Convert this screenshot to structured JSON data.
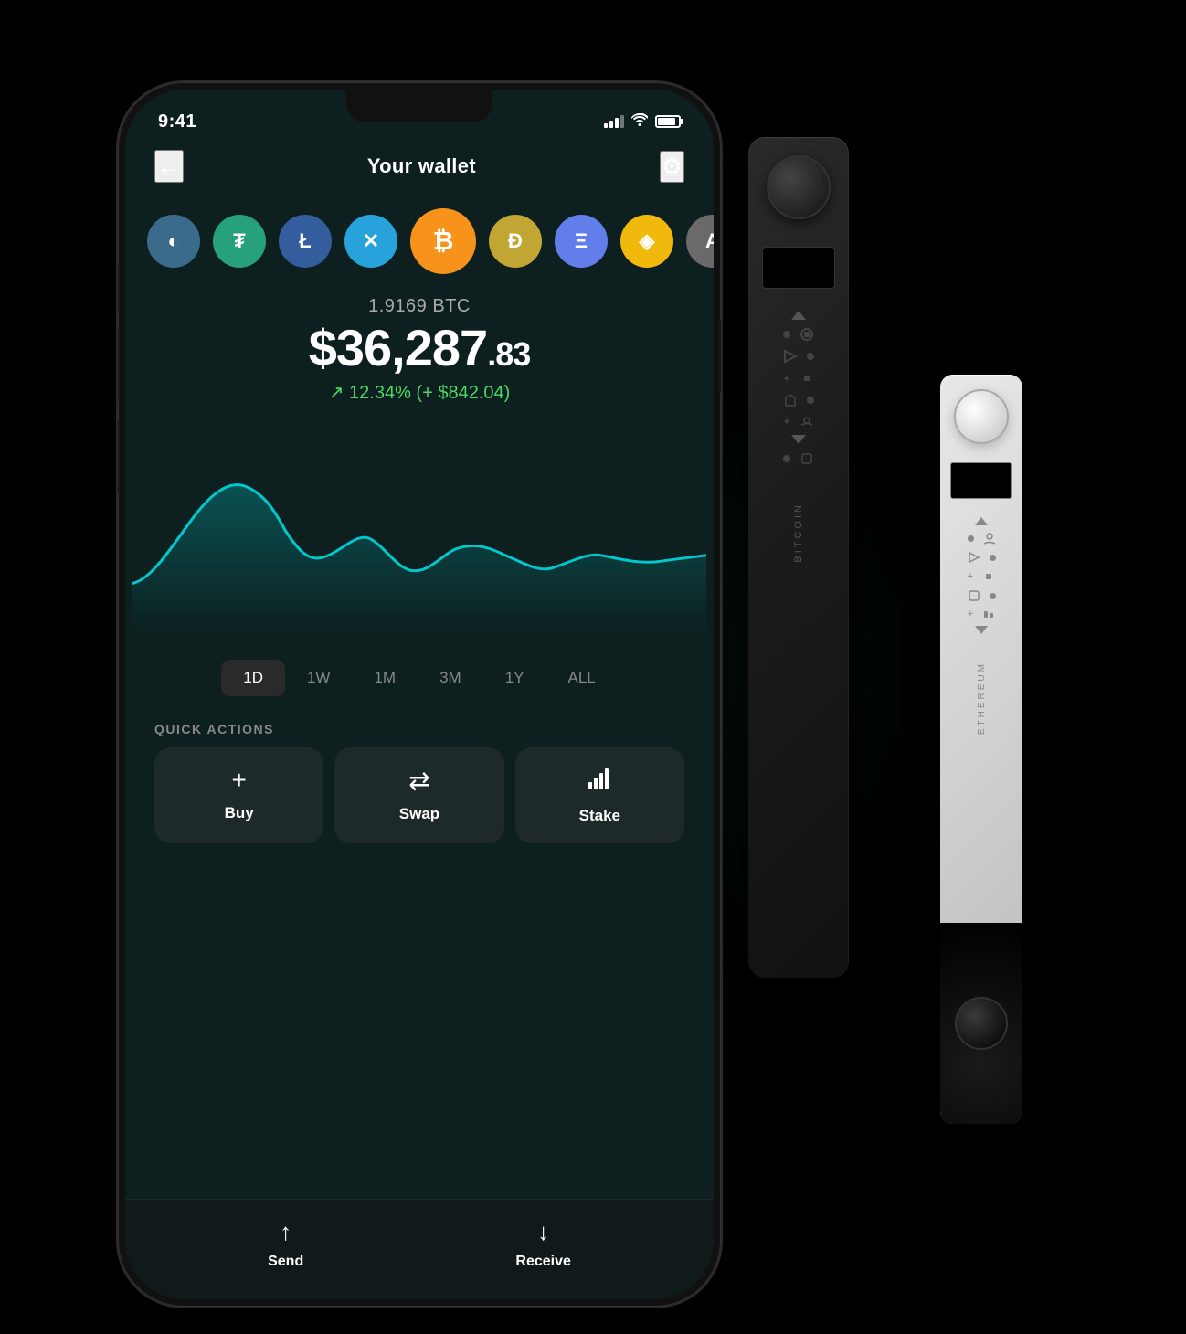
{
  "app": {
    "status_time": "9:41",
    "title": "Your wallet",
    "back_label": "←",
    "settings_label": "⚙"
  },
  "coins": [
    {
      "id": "partial",
      "symbol": "◐",
      "class": "coin-partial"
    },
    {
      "id": "usdt",
      "symbol": "₮",
      "class": "coin-usdt"
    },
    {
      "id": "ltc",
      "symbol": "Ł",
      "class": "coin-ltc"
    },
    {
      "id": "xrp",
      "symbol": "✕",
      "class": "coin-xrp"
    },
    {
      "id": "btc",
      "symbol": "₿",
      "class": "coin-btc"
    },
    {
      "id": "doge",
      "symbol": "Ð",
      "class": "coin-doge"
    },
    {
      "id": "eth",
      "symbol": "Ξ",
      "class": "coin-eth"
    },
    {
      "id": "bnb",
      "symbol": "◈",
      "class": "coin-bnb"
    },
    {
      "id": "algo",
      "symbol": "A",
      "class": "coin-algo"
    }
  ],
  "price": {
    "btc_amount": "1.9169 BTC",
    "usd_main": "$36,287",
    "usd_cents": ".83",
    "change_text": "↗ 12.34% (+ $842.04)",
    "change_color": "#4cd964"
  },
  "chart": {
    "color": "#00c8cc",
    "period": "1D"
  },
  "time_periods": [
    {
      "label": "1D",
      "active": true
    },
    {
      "label": "1W",
      "active": false
    },
    {
      "label": "1M",
      "active": false
    },
    {
      "label": "3M",
      "active": false
    },
    {
      "label": "1Y",
      "active": false
    },
    {
      "label": "ALL",
      "active": false
    }
  ],
  "quick_actions": {
    "label": "QUICK ACTIONS",
    "buttons": [
      {
        "id": "buy",
        "icon": "+",
        "label": "Buy"
      },
      {
        "id": "swap",
        "icon": "⇄",
        "label": "Swap"
      },
      {
        "id": "stake",
        "icon": "📶",
        "label": "Stake"
      }
    ]
  },
  "bottom_bar": {
    "buttons": [
      {
        "id": "send",
        "icon": "↑",
        "label": "Send"
      },
      {
        "id": "receive",
        "icon": "↓",
        "label": "Receive"
      }
    ]
  },
  "hardware": {
    "black": {
      "label": "Bitcoin"
    },
    "white": {
      "label": "Ethereum"
    }
  }
}
